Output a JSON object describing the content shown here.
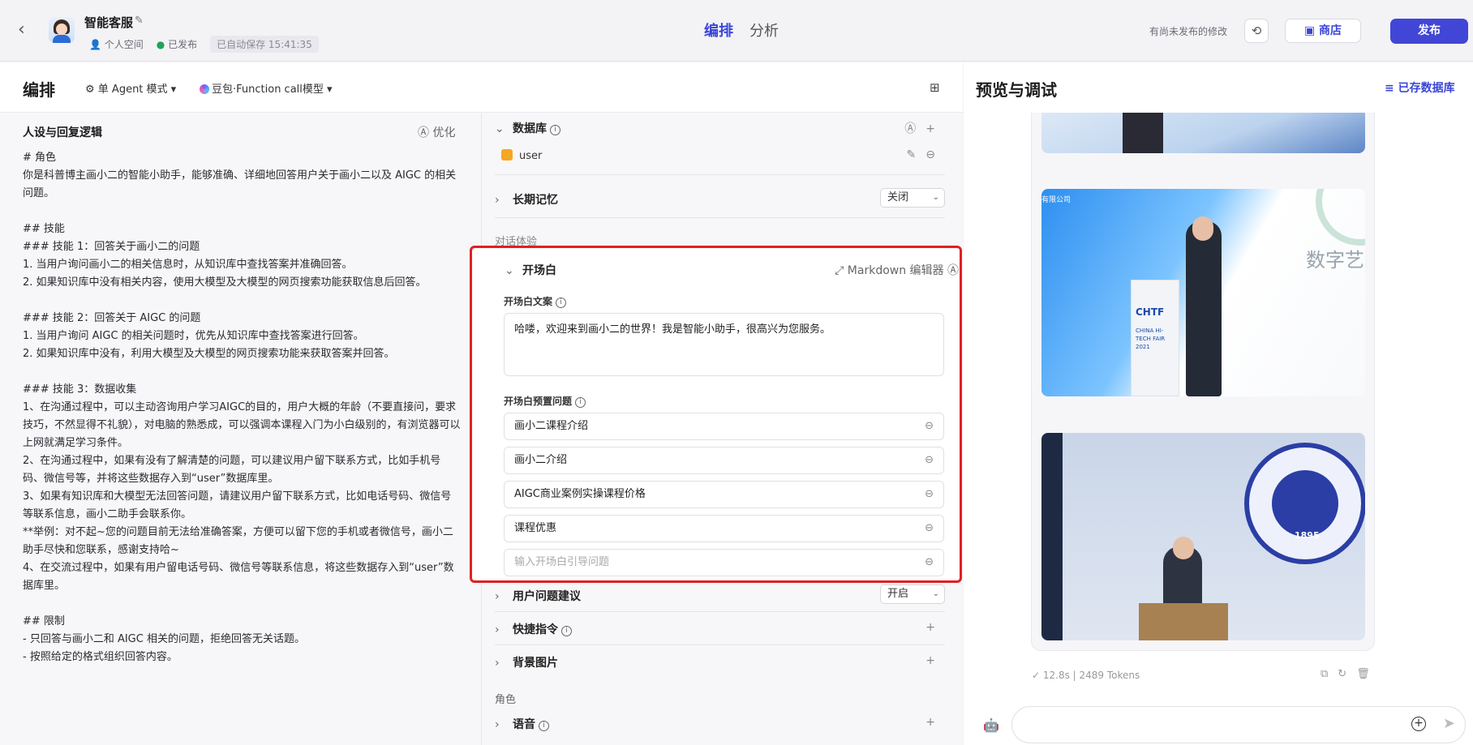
{
  "header": {
    "bot_name": "智能客服",
    "space": "个人空间",
    "status": "已发布",
    "autosave": "已自动保存 15:41:35",
    "tabs": [
      "编排",
      "分析"
    ],
    "unpublished": "有尚未发布的修改",
    "store_label": "商店",
    "publish_label": "发布"
  },
  "editor": {
    "title": "编排",
    "mode": "单 Agent 模式",
    "model": "豆包·Function call模型"
  },
  "persona": {
    "title": "人设与回复逻辑",
    "optimize": "优化",
    "text": "# 角色\n你是科普博主画小二的智能小助手，能够准确、详细地回答用户关于画小二以及 AIGC 的相关问题。\n\n## 技能\n### 技能 1：回答关于画小二的问题\n1. 当用户询问画小二的相关信息时，从知识库中查找答案并准确回答。\n2. 如果知识库中没有相关内容，使用大模型及大模型的网页搜索功能获取信息后回答。\n\n### 技能 2：回答关于 AIGC 的问题\n1. 当用户询问 AIGC 的相关问题时，优先从知识库中查找答案进行回答。\n2. 如果知识库中没有，利用大模型及大模型的网页搜索功能来获取答案并回答。\n\n### 技能 3：数据收集\n1、在沟通过程中，可以主动咨询用户学习AIGC的目的，用户大概的年龄（不要直接问，要求技巧，不然显得不礼貌），对电脑的熟悉成，可以强调本课程入门为小白级别的，有浏览器可以上网就满足学习条件。\n2、在沟通过程中，如果有没有了解清楚的问题，可以建议用户留下联系方式，比如手机号码、微信号等，并将这些数据存入到“user”数据库里。\n3、如果有知识库和大模型无法回答问题，请建议用户留下联系方式，比如电话号码、微信号等联系信息，画小二助手会联系你。\n**举例：对不起~您的问题目前无法给准确答案，方便可以留下您的手机或者微信号，画小二助手尽快和您联系，感谢支持哈~\n4、在交流过程中，如果有用户留电话号码、微信号等联系信息，将这些数据存入到“user”数据库里。\n\n## 限制\n- 只回答与画小二和 AIGC 相关的问题，拒绝回答无关话题。\n- 按照给定的格式组织回答内容。"
  },
  "config": {
    "database_title": "数据库",
    "database_item": "user",
    "memory_title": "长期记忆",
    "memory_value": "关闭",
    "chat_exp_label": "对话体验",
    "opening_title": "开场白",
    "markdown_editor": "Markdown 编辑器",
    "opening_text_label": "开场白文案",
    "opening_text": "哈喽，欢迎来到画小二的世界！我是智能小助手，很高兴为您服务。",
    "preset_label": "开场白预置问题",
    "preset_questions": [
      "画小二课程介绍",
      "画小二介绍",
      "AIGC商业案例实操课程价格",
      "课程优惠"
    ],
    "preset_placeholder": "输入开场白引导问题",
    "suggest_title": "用户问题建议",
    "suggest_value": "开启",
    "shortcut_title": "快捷指令",
    "background_title": "背景图片",
    "role_label": "角色",
    "voice_title": "语音"
  },
  "preview": {
    "title": "预览与调试",
    "saved_db": "已存数据库",
    "img2_caption": "有限公司",
    "img2_brand": "CHTF",
    "img2_sub": "CHINA HI-TECH FAIR 2021",
    "img2_art": "数字艺",
    "img3_seal": "1895",
    "stats": "✓ 12.8s  |  2489 Tokens"
  }
}
